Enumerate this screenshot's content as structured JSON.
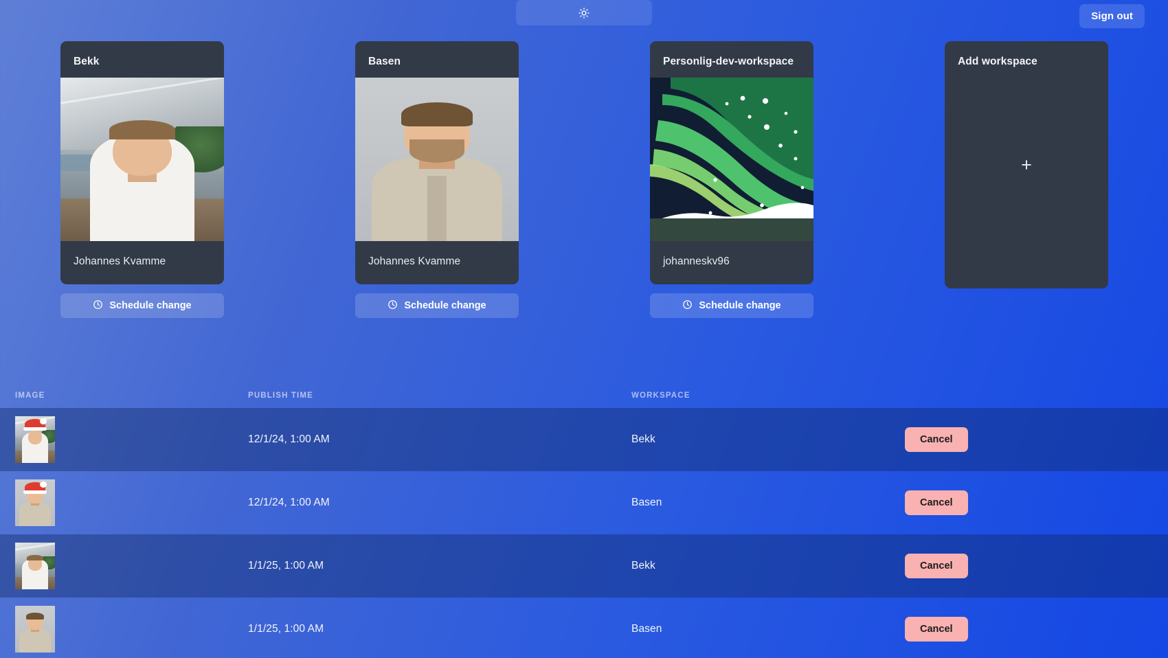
{
  "topbar": {
    "theme_toggle_icon": "sun-icon",
    "sign_out_label": "Sign out"
  },
  "workspaces": [
    {
      "title": "Bekk",
      "user": "Johannes Kvamme",
      "schedule_label": "Schedule change",
      "schedule_icon": "clock-icon",
      "image_kind": "photo-outdoor-portrait"
    },
    {
      "title": "Basen",
      "user": "Johannes Kvamme",
      "schedule_label": "Schedule change",
      "schedule_icon": "clock-icon",
      "image_kind": "photo-studio-portrait"
    },
    {
      "title": "Personlig-dev-workspace",
      "user": "johanneskv96",
      "schedule_label": "Schedule change",
      "schedule_icon": "clock-icon",
      "image_kind": "aurora-illustration"
    }
  ],
  "add_workspace": {
    "title": "Add workspace",
    "plus_icon": "plus-icon",
    "plus_glyph": "+"
  },
  "table": {
    "columns": [
      "IMAGE",
      "PUBLISH TIME",
      "WORKSPACE",
      ""
    ],
    "rows": [
      {
        "image_alt": "santa-hat-outdoor-portrait",
        "publish_time": "12/1/24, 1:00 AM",
        "workspace": "Bekk",
        "action_label": "Cancel"
      },
      {
        "image_alt": "santa-hat-studio-portrait",
        "publish_time": "12/1/24, 1:00 AM",
        "workspace": "Basen",
        "action_label": "Cancel"
      },
      {
        "image_alt": "outdoor-portrait",
        "publish_time": "1/1/25, 1:00 AM",
        "workspace": "Bekk",
        "action_label": "Cancel"
      },
      {
        "image_alt": "studio-portrait",
        "publish_time": "1/1/25, 1:00 AM",
        "workspace": "Basen",
        "action_label": "Cancel"
      }
    ]
  },
  "colors": {
    "background_from": "#5f7fd6",
    "background_to": "#1447e4",
    "card_surface": "#323a47",
    "cancel_button_bg": "#f9b1b1",
    "cancel_button_text": "#1c1c1c",
    "row_stripe": "rgba(12,38,92,0.38)"
  }
}
